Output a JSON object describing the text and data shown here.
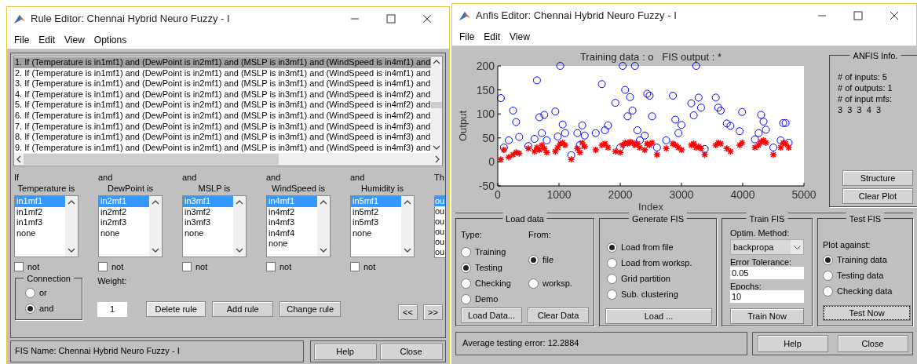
{
  "rule_editor": {
    "title": "Rule Editor: Chennai Hybrid Neuro Fuzzy - I",
    "menu": [
      "File",
      "Edit",
      "View",
      "Options"
    ],
    "rules": [
      {
        "text": "1. If (Temperature is in1mf1) and (DewPoint is in2mf1) and (MSLP is in3mf1) and (WindSpeed is in4mf1) and",
        "selected": true
      },
      {
        "text": "2. If (Temperature is in1mf1) and (DewPoint is in2mf1) and (MSLP is in3mf1) and (WindSpeed is in4mf1) and",
        "selected": false
      },
      {
        "text": "3. If (Temperature is in1mf1) and (DewPoint is in2mf1) and (MSLP is in3mf1) and (WindSpeed is in4mf1) and",
        "selected": false
      },
      {
        "text": "4. If (Temperature is in1mf1) and (DewPoint is in2mf1) and (MSLP is in3mf1) and (WindSpeed is in4mf2) and",
        "selected": false
      },
      {
        "text": "5. If (Temperature is in1mf1) and (DewPoint is in2mf1) and (MSLP is in3mf1) and (WindSpeed is in4mf2) and",
        "selected": false
      },
      {
        "text": "6. If (Temperature is in1mf1) and (DewPoint is in2mf1) and (MSLP is in3mf1) and (WindSpeed is in4mf2) and",
        "selected": false
      },
      {
        "text": "7. If (Temperature is in1mf1) and (DewPoint is in2mf1) and (MSLP is in3mf1) and (WindSpeed is in4mf3) and",
        "selected": false
      },
      {
        "text": "8. If (Temperature is in1mf1) and (DewPoint is in2mf1) and (MSLP is in3mf1) and (WindSpeed is in4mf3) and",
        "selected": false
      },
      {
        "text": "9. If (Temperature is in1mf1) and (DewPoint is in2mf1) and (MSLP is in3mf1) and (WindSpeed is in4mf3) and",
        "selected": false
      }
    ],
    "antecedents": [
      {
        "connective": "If",
        "label": "Temperature is",
        "not": false,
        "not_label": "not",
        "options": [
          {
            "label": "in1mf1",
            "selected": true
          },
          {
            "label": "in1mf2",
            "selected": false
          },
          {
            "label": "in1mf3",
            "selected": false
          },
          {
            "label": "none",
            "selected": false
          }
        ]
      },
      {
        "connective": "and",
        "label": "DewPoint is",
        "not": false,
        "not_label": "not",
        "options": [
          {
            "label": "in2mf1",
            "selected": true
          },
          {
            "label": "in2mf2",
            "selected": false
          },
          {
            "label": "in2mf3",
            "selected": false
          },
          {
            "label": "none",
            "selected": false
          }
        ]
      },
      {
        "connective": "and",
        "label": "MSLP is",
        "not": false,
        "not_label": "not",
        "options": [
          {
            "label": "in3mf1",
            "selected": true
          },
          {
            "label": "in3mf2",
            "selected": false
          },
          {
            "label": "in3mf3",
            "selected": false
          },
          {
            "label": "none",
            "selected": false
          }
        ]
      },
      {
        "connective": "and",
        "label": "WindSpeed is",
        "not": false,
        "not_label": "not",
        "options": [
          {
            "label": "in4mf1",
            "selected": true
          },
          {
            "label": "in4mf2",
            "selected": false
          },
          {
            "label": "in4mf3",
            "selected": false
          },
          {
            "label": "in4mf4",
            "selected": false
          },
          {
            "label": "none",
            "selected": false
          }
        ]
      },
      {
        "connective": "and",
        "label": "Humidity is",
        "not": false,
        "not_label": "not",
        "options": [
          {
            "label": "in5mf1",
            "selected": true
          },
          {
            "label": "in5mf2",
            "selected": false
          },
          {
            "label": "in5mf3",
            "selected": false
          },
          {
            "label": "none",
            "selected": false
          }
        ]
      }
    ],
    "cut_column": {
      "connective": "Th",
      "options": [
        {
          "label": "ou",
          "selected": true
        },
        {
          "label": "ou",
          "selected": false
        },
        {
          "label": "ou",
          "selected": false
        },
        {
          "label": "ou",
          "selected": false
        },
        {
          "label": "ou",
          "selected": false
        },
        {
          "label": "ou",
          "selected": false
        }
      ]
    },
    "connection_title": "Connection",
    "connection": [
      {
        "label": "or",
        "selected": false
      },
      {
        "label": "and",
        "selected": true
      }
    ],
    "weight_label": "Weight:",
    "weight": "1",
    "buttons": [
      "Delete rule",
      "Add rule",
      "Change rule"
    ],
    "nav_buttons": [
      "<<",
      ">>"
    ],
    "status": "FIS Name: Chennai Hybrid Neuro Fuzzy - I",
    "footer_buttons": [
      "Help",
      "Close"
    ]
  },
  "anfis_editor": {
    "title": "Anfis Editor: Chennai Hybrid Neuro Fuzzy - I",
    "menu": [
      "File",
      "Edit",
      "View"
    ],
    "chart_data": {
      "type": "scatter",
      "title": "Training data : o   FIS output : *",
      "xlabel": "Index",
      "ylabel": "Output",
      "xlim": [
        0,
        5000
      ],
      "ylim": [
        -50,
        200
      ],
      "xticks": [
        0,
        1000,
        2000,
        3000,
        4000,
        5000
      ],
      "yticks": [
        -50,
        0,
        50,
        100,
        150,
        200
      ],
      "x": [
        50,
        100,
        180,
        250,
        300,
        350,
        500,
        600,
        640,
        680,
        720,
        760,
        800,
        940,
        980,
        1020,
        1060,
        1100,
        1200,
        1300,
        1340,
        1380,
        1420,
        1600,
        1700,
        1750,
        1800,
        1920,
        2000,
        2040,
        2080,
        2120,
        2160,
        2200,
        2240,
        2280,
        2320,
        2400,
        2440,
        2480,
        2520,
        2600,
        2750,
        2860,
        2900,
        2950,
        3000,
        3160,
        3200,
        3240,
        3280,
        3320,
        3380,
        3560,
        3600,
        3640,
        3740,
        3800,
        3950,
        3990,
        4200,
        4260,
        4300,
        4340,
        4380,
        4500,
        4620,
        4660,
        4700,
        4750
      ],
      "series": [
        {
          "color": "#0000ff",
          "values": [
            133,
            30,
            45,
            107,
            83,
            52,
            33,
            48,
            170,
            93,
            60,
            98,
            45,
            105,
            53,
            200,
            78,
            60,
            14,
            60,
            35,
            76,
            55,
            60,
            162,
            66,
            76,
            123,
            30,
            200,
            150,
            95,
            135,
            107,
            200,
            66,
            45,
            55,
            142,
            138,
            95,
            30,
            45,
            138,
            88,
            60,
            77,
            122,
            97,
            200,
            134,
            113,
            27,
            134,
            113,
            107,
            80,
            75,
            64,
            104,
            47,
            60,
            98,
            84,
            67,
            30,
            45,
            81,
            81,
            40
          ]
        },
        {
          "color": "#ff0000",
          "values": [
            5,
            25,
            10,
            15,
            20,
            18,
            28,
            22,
            30,
            25,
            35,
            28,
            20,
            22,
            30,
            38,
            40,
            35,
            5,
            28,
            20,
            40,
            32,
            25,
            35,
            38,
            30,
            22,
            20,
            35,
            40,
            38,
            42,
            40,
            35,
            38,
            30,
            25,
            38,
            35,
            40,
            15,
            28,
            38,
            35,
            30,
            25,
            35,
            38,
            30,
            32,
            28,
            15,
            35,
            40,
            38,
            28,
            22,
            35,
            40,
            30,
            35,
            42,
            45,
            40,
            15,
            30,
            40,
            38,
            30
          ]
        }
      ]
    },
    "info_title": "ANFIS Info.",
    "info_lines": [
      "# of inputs: 5",
      "# of outputs: 1",
      "# of input mfs:",
      "3  3  3  4  3"
    ],
    "info_buttons": [
      "Structure",
      "Clear Plot"
    ],
    "load_data": {
      "title": "Load data",
      "type_label": "Type:",
      "from_label": "From:",
      "types": [
        {
          "label": "Training",
          "selected": false
        },
        {
          "label": "Testing",
          "selected": true
        },
        {
          "label": "Checking",
          "selected": false
        },
        {
          "label": "Demo",
          "selected": false
        }
      ],
      "sources": [
        {
          "label": "file",
          "selected": true
        },
        {
          "label": "worksp.",
          "selected": false
        }
      ],
      "buttons": [
        "Load Data...",
        "Clear Data"
      ]
    },
    "generate_fis": {
      "title": "Generate FIS",
      "options": [
        {
          "label": "Load from file",
          "selected": true
        },
        {
          "label": "Load from worksp.",
          "selected": false
        },
        {
          "label": "Grid partition",
          "selected": false
        },
        {
          "label": "Sub. clustering",
          "selected": false
        }
      ],
      "button": "Load ..."
    },
    "train_fis": {
      "title": "Train FIS",
      "method_label": "Optim. Method:",
      "method": "backpropa",
      "tolerance_label": "Error Tolerance:",
      "tolerance": "0.05",
      "epochs_label": "Epochs:",
      "epochs": "10",
      "button": "Train Now"
    },
    "test_fis": {
      "title": "Test FIS",
      "plot_label": "Plot against:",
      "options": [
        {
          "label": "Training data",
          "selected": true
        },
        {
          "label": "Testing data",
          "selected": false
        },
        {
          "label": "Checking data",
          "selected": false
        }
      ],
      "button": "Test Now"
    },
    "status": "Average testing error: 12.2884",
    "footer_buttons": [
      "Help",
      "Close"
    ]
  }
}
